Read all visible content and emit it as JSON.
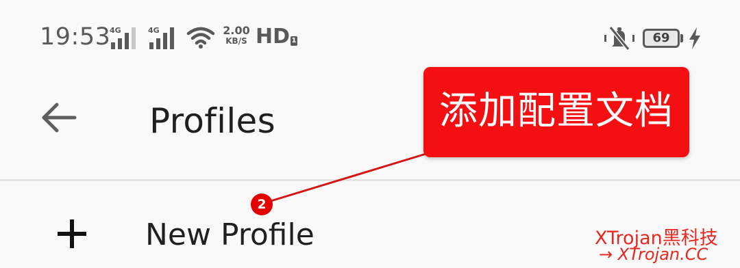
{
  "status_bar": {
    "time": "19:53",
    "sim1_label": "4G",
    "sim2_label": "4G",
    "net_speed_value": "2.00",
    "net_speed_unit": "KB/S",
    "hd_label": "HD",
    "hd_sub": "1",
    "battery_percent": "69",
    "battery_level": 0.69,
    "icons": [
      "signal-icon",
      "wifi-icon",
      "mute-icon",
      "battery-icon",
      "charging-icon"
    ]
  },
  "app_bar": {
    "title": "Profiles",
    "back_icon": "arrow-left-icon"
  },
  "list": {
    "items": [
      {
        "label": "New Profile",
        "icon": "plus-icon"
      }
    ]
  },
  "annotation": {
    "label": "添加配置文档",
    "step": "2",
    "color": "#f40f13"
  },
  "watermark": {
    "line1": "XTrojan黑科技",
    "line2": "→ XTrojan.CC"
  },
  "colors": {
    "background": "#f9f9f9",
    "status_icons": "#595959",
    "text": "#202020",
    "annotation_red": "#f40f13"
  }
}
